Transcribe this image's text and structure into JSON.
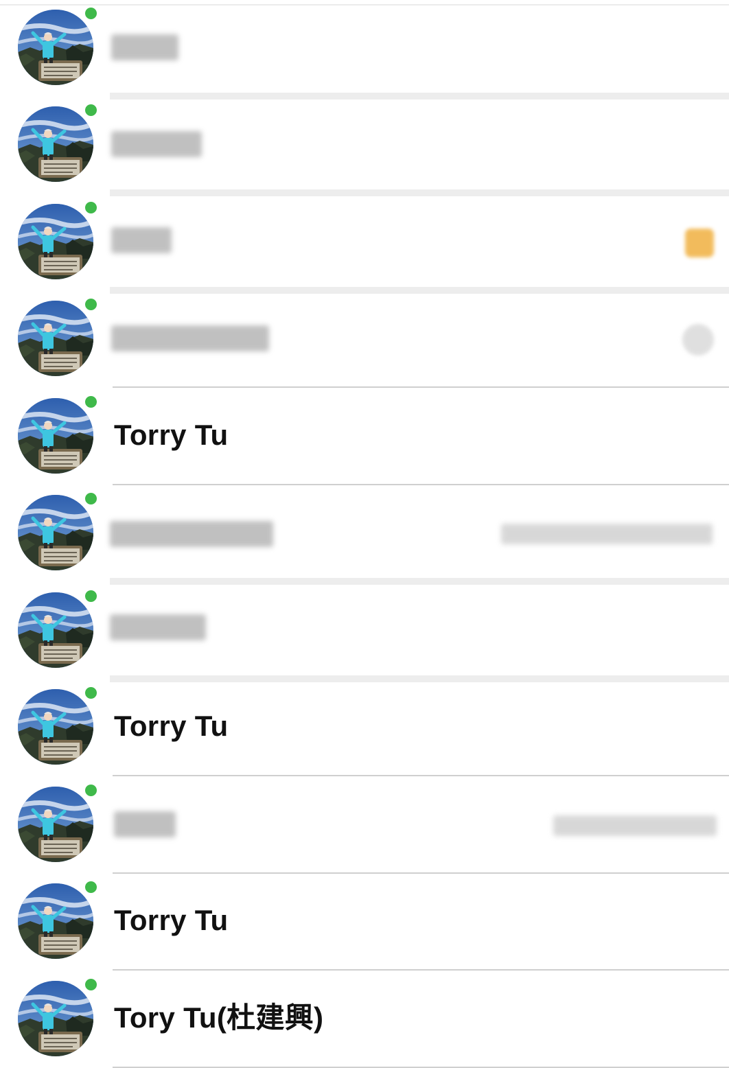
{
  "contacts": [
    {
      "name": "",
      "redacted": true,
      "online": true
    },
    {
      "name": "",
      "redacted": true,
      "online": true
    },
    {
      "name": "",
      "redacted": true,
      "online": true,
      "status": "emoji"
    },
    {
      "name": "",
      "redacted": true,
      "online": true,
      "status": "icon"
    },
    {
      "name": "Torry Tu",
      "redacted": false,
      "online": true
    },
    {
      "name": "",
      "redacted": true,
      "online": true,
      "right_text_redacted": true
    },
    {
      "name": "",
      "redacted": true,
      "online": true
    },
    {
      "name": "Torry Tu",
      "redacted": false,
      "online": true
    },
    {
      "name": "",
      "redacted": true,
      "online": true,
      "right_text_redacted": true
    },
    {
      "name": "Torry Tu",
      "redacted": false,
      "online": true
    },
    {
      "name": "Tory Tu(杜建興)",
      "redacted": false,
      "online": true
    }
  ],
  "colors": {
    "online": "#3fb94a",
    "separator": "#cfcfcf",
    "text": "#111111"
  }
}
